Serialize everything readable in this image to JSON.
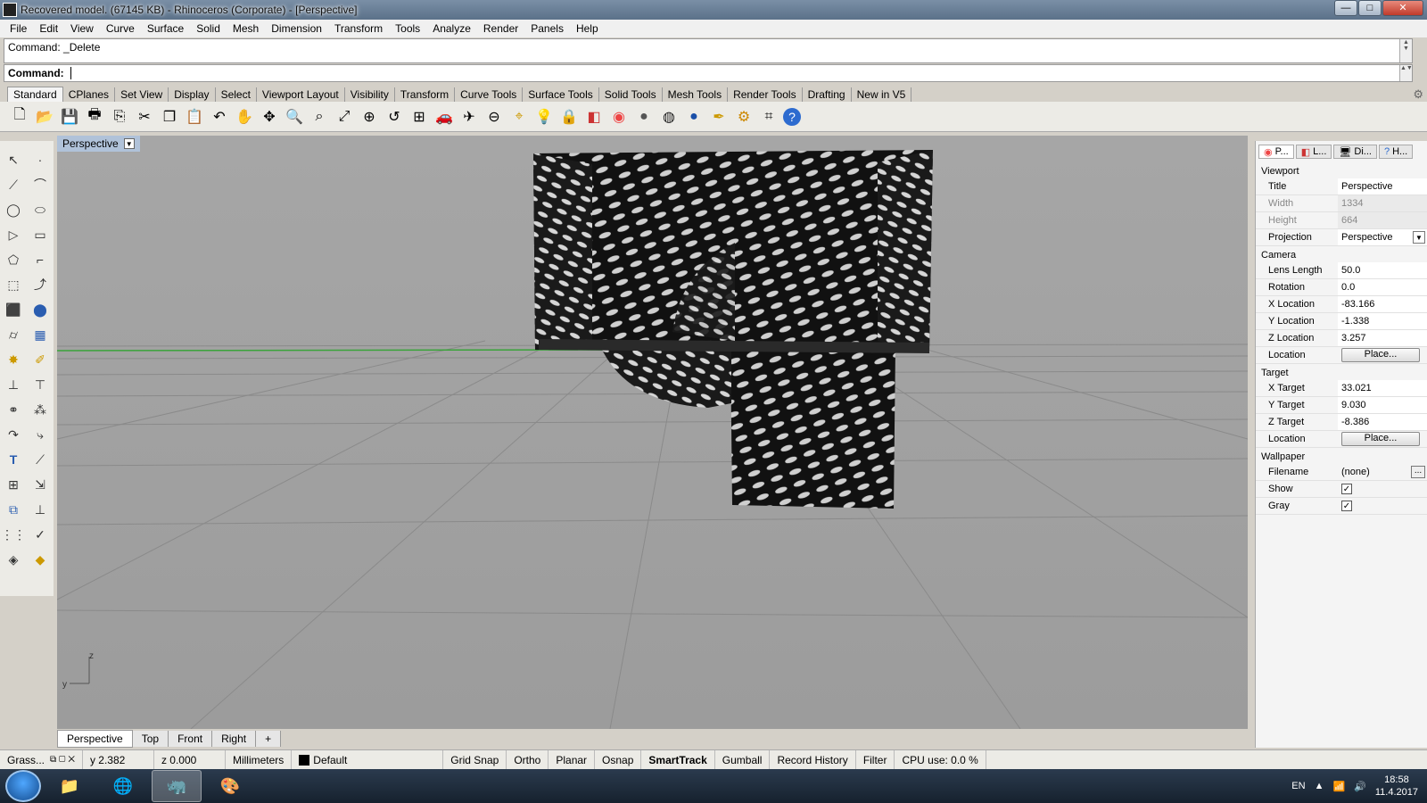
{
  "window": {
    "title": "Recovered model. (67145 KB) - Rhinoceros (Corporate) - [Perspective]",
    "buttons": [
      "minimize",
      "maximize",
      "close"
    ]
  },
  "menu": [
    "File",
    "Edit",
    "View",
    "Curve",
    "Surface",
    "Solid",
    "Mesh",
    "Dimension",
    "Transform",
    "Tools",
    "Analyze",
    "Render",
    "Panels",
    "Help"
  ],
  "command": {
    "history": "Command: _Delete",
    "prompt": "Command:"
  },
  "tabs": [
    "Standard",
    "CPlanes",
    "Set View",
    "Display",
    "Select",
    "Viewport Layout",
    "Visibility",
    "Transform",
    "Curve Tools",
    "Surface Tools",
    "Solid Tools",
    "Mesh Tools",
    "Render Tools",
    "Drafting",
    "New in V5"
  ],
  "toolbar_icons": [
    "new-icon",
    "open-icon",
    "save-icon",
    "print-icon",
    "copy-to-clipboard-icon",
    "cut-icon",
    "copy-icon",
    "paste-icon",
    "undo-icon",
    "pan-icon",
    "rotate-view-icon",
    "zoom-icon",
    "zoom-window-icon",
    "zoom-extents-icon",
    "zoom-selected-icon",
    "undo-view-icon",
    "four-viewports-icon",
    "car-icon",
    "named-views-icon",
    "cplane-icon",
    "snap-icon",
    "light-icon",
    "lock-icon",
    "layer-icon",
    "color-wheel-icon",
    "shade-icon",
    "rendered-icon",
    "render-icon",
    "sphere-icon",
    "drafting-icon",
    "options-icon",
    "grasshopper-icon",
    "help-icon"
  ],
  "left_tools": [
    "select-icon",
    "point-icon",
    "polyline-icon",
    "control-point-curve-icon",
    "circle-icon",
    "ellipse-icon",
    "polygon-icon",
    "rectangle-icon",
    "arc-icon",
    "curve-fillet-icon",
    "surface-corner-icon",
    "extrude-icon",
    "box-icon",
    "sphere-solid-icon",
    "cylinder-icon",
    "mesh-icon",
    "explode-icon",
    "trim-icon",
    "join-icon",
    "split-icon",
    "boolean-icon",
    "group-icon",
    "fillet-icon",
    "offset-icon",
    "text-icon",
    "dimension-icon",
    "array-icon",
    "move-icon",
    "scale-icon",
    "analyze-icon",
    "block-icon",
    "check-icon",
    "render-object-icon",
    "paint-icon"
  ],
  "viewport": {
    "title": "Perspective",
    "axis_z": "z",
    "axis_y": "y"
  },
  "viewport_tabs": [
    "Perspective",
    "Top",
    "Front",
    "Right"
  ],
  "panel": {
    "tabs": [
      "P...",
      "L...",
      "Di...",
      "H..."
    ],
    "viewport_section": "Viewport",
    "title_label": "Title",
    "title_value": "Perspective",
    "width_label": "Width",
    "width_value": "1334",
    "height_label": "Height",
    "height_value": "664",
    "projection_label": "Projection",
    "projection_value": "Perspective",
    "camera_section": "Camera",
    "lens_label": "Lens Length",
    "lens_value": "50.0",
    "rotation_label": "Rotation",
    "rotation_value": "0.0",
    "xloc_label": "X Location",
    "xloc_value": "-83.166",
    "yloc_label": "Y Location",
    "yloc_value": "-1.338",
    "zloc_label": "Z Location",
    "zloc_value": "3.257",
    "location_label": "Location",
    "place_button": "Place...",
    "target_section": "Target",
    "xtarget_label": "X Target",
    "xtarget_value": "33.021",
    "ytarget_label": "Y Target",
    "ytarget_value": "9.030",
    "ztarget_label": "Z Target",
    "ztarget_value": "-8.386",
    "target_location_label": "Location",
    "wallpaper_section": "Wallpaper",
    "filename_label": "Filename",
    "filename_value": "(none)",
    "filename_button": "...",
    "show_label": "Show",
    "show_checked": true,
    "gray_label": "Gray",
    "gray_checked": true
  },
  "status": {
    "grasshopper": "Grass...",
    "y": "y 2.382",
    "z": "z 0.000",
    "units": "Millimeters",
    "layer": "Default",
    "grid_snap": "Grid Snap",
    "ortho": "Ortho",
    "planar": "Planar",
    "osnap": "Osnap",
    "smarttrack": "SmartTrack",
    "gumball": "Gumball",
    "record_history": "Record History",
    "filter": "Filter",
    "cpu": "CPU use: 0.0 %"
  },
  "taskbar": {
    "apps": [
      "explorer-icon",
      "chrome-icon",
      "rhino-icon",
      "paint-icon"
    ],
    "lang": "EN",
    "time": "18:58",
    "date": "11.4.2017"
  }
}
